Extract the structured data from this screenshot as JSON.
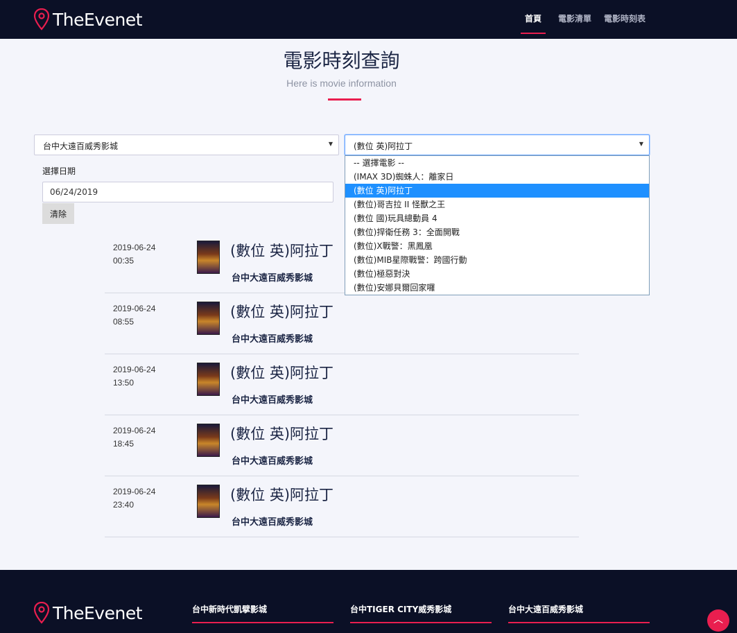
{
  "brand": {
    "name": "TheEvenet",
    "accent": "#e91e4f",
    "nav_bg": "#0b1026"
  },
  "nav": [
    {
      "label": "首頁",
      "active": true
    },
    {
      "label": "電影清單",
      "active": false
    },
    {
      "label": "電影時刻表",
      "active": false
    }
  ],
  "page": {
    "title": "電影時刻查詢",
    "subtitle": "Here is movie information"
  },
  "filters": {
    "theater_value": "台中大遠百威秀影城",
    "movie_value": "(數位 英)阿拉丁",
    "movie_options": [
      "-- 選擇電影 --",
      "(IMAX 3D)蜘蛛人：離家日",
      "(數位 英)阿拉丁",
      "(數位)哥吉拉 II 怪獸之王",
      "(數位 國)玩具總動員 4",
      "(數位)捍衛任務 3：全面開戰",
      "(數位)X戰警：黑鳳凰",
      "(數位)MIB星際戰警：跨國行動",
      "(數位)極惡對決",
      "(數位)安娜貝爾回家囉"
    ],
    "selected_index": 2,
    "date_label": "選擇日期",
    "date_value": "06/24/2019",
    "clear_label": "清除"
  },
  "showtimes": [
    {
      "date": "2019-06-24",
      "time": "00:35",
      "title": "(數位 英)阿拉丁",
      "theater": "台中大遠百威秀影城"
    },
    {
      "date": "2019-06-24",
      "time": "08:55",
      "title": "(數位 英)阿拉丁",
      "theater": "台中大遠百威秀影城"
    },
    {
      "date": "2019-06-24",
      "time": "13:50",
      "title": "(數位 英)阿拉丁",
      "theater": "台中大遠百威秀影城"
    },
    {
      "date": "2019-06-24",
      "time": "18:45",
      "title": "(數位 英)阿拉丁",
      "theater": "台中大遠百威秀影城"
    },
    {
      "date": "2019-06-24",
      "time": "23:40",
      "title": "(數位 英)阿拉丁",
      "theater": "台中大遠百威秀影城"
    }
  ],
  "footer": {
    "columns": [
      "台中新時代凱擘影城",
      "台中TIGER CITY威秀影城",
      "台中大遠百威秀影城"
    ]
  }
}
